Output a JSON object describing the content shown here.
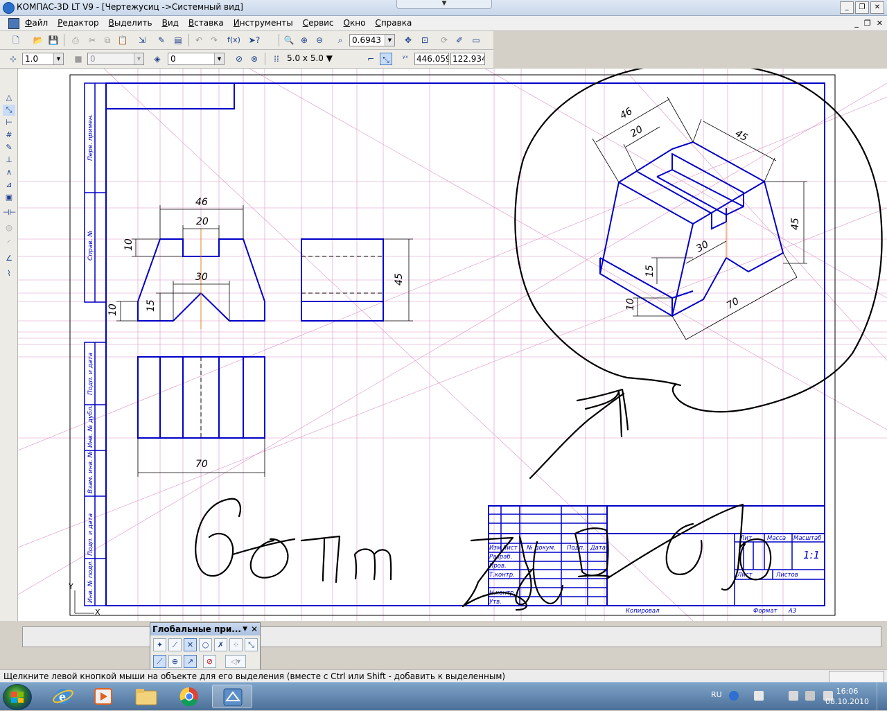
{
  "window": {
    "title": "КОМПАС-3D LT V9 - [Чертежусиц ->Системный вид]"
  },
  "menu": [
    "Файл",
    "Редактор",
    "Выделить",
    "Вид",
    "Вставка",
    "Инструменты",
    "Сервис",
    "Окно",
    "Справка"
  ],
  "toolbar1": {
    "zoom_value": "0.6943"
  },
  "toolbar2": {
    "line_style": "1.0",
    "layer_disabled": "0",
    "layer": "0",
    "grid": "5.0 x 5.0",
    "coord_x": "446.059",
    "coord_y": "122.934"
  },
  "drawing": {
    "dims": {
      "front_46": "46",
      "front_20": "20",
      "front_10_top": "10",
      "front_30": "30",
      "front_15": "15",
      "front_10_bottom": "10",
      "side_45": "45",
      "plan_70": "70",
      "iso_46": "46",
      "iso_20": "20",
      "iso_45_top": "45",
      "iso_45_right": "45",
      "iso_30": "30",
      "iso_15": "15",
      "iso_10": "10",
      "iso_70": "70"
    },
    "side_stamp": [
      "Перв. примен.",
      "Справ. №",
      "Подп. и дата",
      "Инв. № дубл.",
      "Взам. инв. №",
      "Подп. и дата",
      "Инв. № подл."
    ],
    "title_block": {
      "col_headers": [
        "Изм",
        "Лист",
        "№ докум.",
        "Подп.",
        "Дата"
      ],
      "rows": [
        "Разраб.",
        "Пров.",
        "Т.контр.",
        "",
        "Н.контр.",
        "Утв."
      ],
      "lit": "Лит.",
      "mass": "Масса",
      "scale": "Масштаб",
      "scale_value": "1:1",
      "sheet": "Лист",
      "sheets": "Листов",
      "copied": "Копировал",
      "format": "Формат",
      "format_value": "A3"
    },
    "axis_x": "X",
    "axis_y": "Y",
    "handwriting": "Вот так"
  },
  "global_panel": {
    "title": "Глобальные при...",
    "close": "✕"
  },
  "status": {
    "message": "Щелкните левой кнопкой мыши на объекте для его выделения (вместе с Ctrl или Shift - добавить к выделенным)"
  },
  "taskbar": {
    "lang": "RU",
    "time": "16:06",
    "date": "08.10.2010"
  },
  "colors": {
    "line_blue": "#0000c8",
    "construction_pink": "#d070b0",
    "axis_orange": "#e08020",
    "handwriting": "#000000"
  }
}
